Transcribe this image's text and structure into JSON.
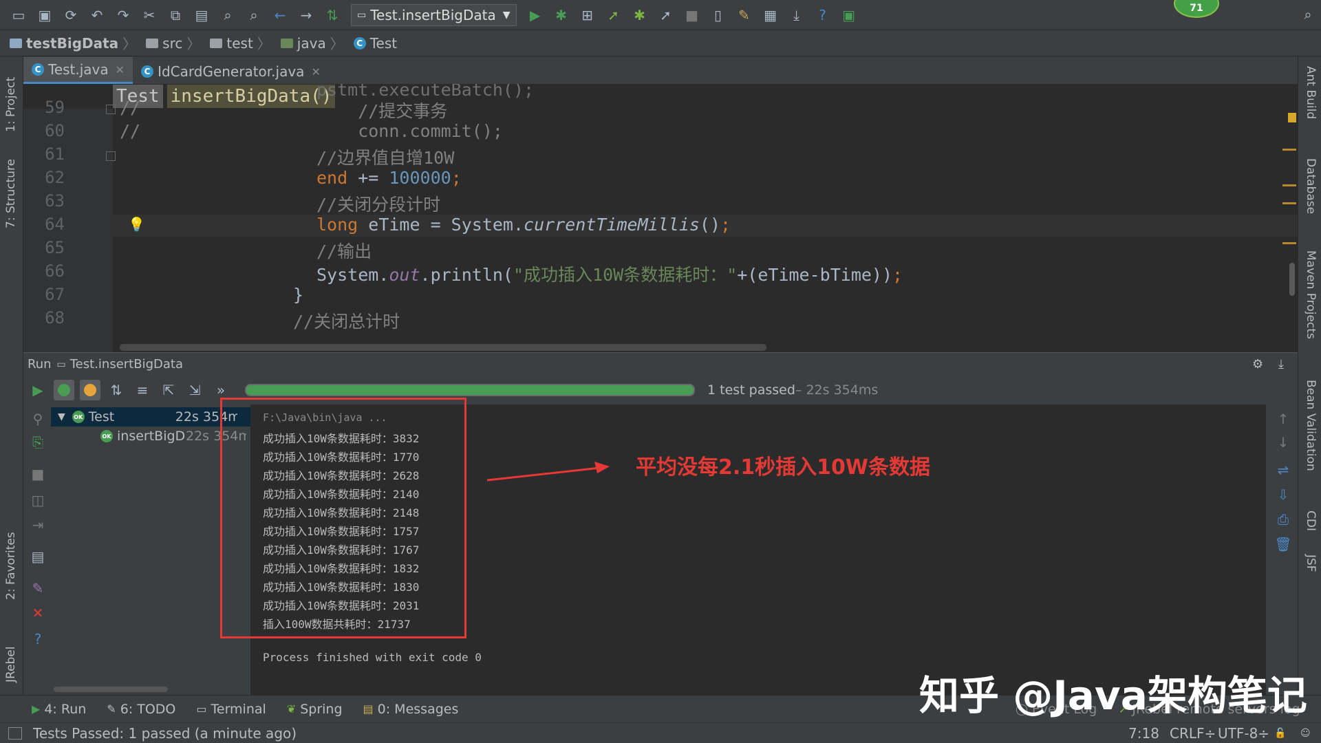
{
  "toolbar": {
    "run_config": "Test.insertBigData",
    "notification_count": "71"
  },
  "breadcrumb": [
    "testBigData",
    "src",
    "test",
    "java",
    "Test"
  ],
  "editor_tabs": [
    {
      "label": "Test.java"
    },
    {
      "label": "IdCardGenerator.java"
    }
  ],
  "editor_crumb": {
    "class": "Test",
    "method": "insertBigData()"
  },
  "editor": {
    "line_numbers": [
      "59",
      "60",
      "61",
      "62",
      "63",
      "64",
      "65",
      "66",
      "67",
      "68"
    ],
    "partial_top": "pstmt.executeBatch();",
    "l59_a": "//",
    "l59_b": "    //提交事务",
    "l60_a": "//",
    "l60_b": "    conn.commit();",
    "l61": "//边界值自增10W",
    "l62_kw": "end",
    "l62_op": " += ",
    "l62_num": "100000",
    "l62_semi": ";",
    "l63": "//关闭分段计时",
    "l64_kw": "long",
    "l64_a": " eTime = System.",
    "l64_m": "currentTimeMillis",
    "l64_b": "()",
    "l64_semi": ";",
    "l65": "//输出",
    "l66_a": "System.",
    "l66_out": "out",
    "l66_b": ".println(",
    "l66_str": "\"成功插入10W条数据耗时：\"",
    "l66_c": "+(eTime-bTime))",
    "l66_semi": ";",
    "l67": "}",
    "l68": "//关闭总计时"
  },
  "run_panel": {
    "label": "Run",
    "config": "Test.insertBigData",
    "status_main": "1 test passed",
    "status_time": " – 22s 354ms"
  },
  "tree": [
    {
      "name": "Test",
      "time": "22s 354ms"
    },
    {
      "name": "insertBigData",
      "time": "22s 354ms"
    }
  ],
  "console": {
    "cmd": "F:\\Java\\bin\\java ...",
    "lines": [
      "成功插入10W条数据耗时：3832",
      "成功插入10W条数据耗时：1770",
      "成功插入10W条数据耗时：2628",
      "成功插入10W条数据耗时：2140",
      "成功插入10W条数据耗时：2148",
      "成功插入10W条数据耗时：1757",
      "成功插入10W条数据耗时：1767",
      "成功插入10W条数据耗时：1832",
      "成功插入10W条数据耗时：1830",
      "成功插入10W条数据耗时：2031",
      "插入100W数据共耗时：21737"
    ],
    "exit": "Process finished with exit code 0"
  },
  "annotation": "平均没每2.1秒插入10W条数据",
  "left_tool_windows": [
    "1: Project",
    "7: Structure",
    "2: Favorites",
    "JRebel"
  ],
  "right_tool_windows": [
    "Ant Build",
    "Database",
    "Maven Projects",
    "Bean Validation",
    "CDI",
    "JSF"
  ],
  "bottom_tabs": [
    "4: Run",
    "6: TODO",
    "Terminal",
    "Spring",
    "0: Messages"
  ],
  "bottom_right": [
    "Event Log",
    "JRebel remote servers log"
  ],
  "status": {
    "message": "Tests Passed: 1 passed (a minute ago)",
    "position": "7:18",
    "line_sep": "CRLF÷",
    "encoding": "UTF-8÷"
  },
  "watermark": "知乎 @Java架构笔记",
  "colors": {
    "accent": "#4a88c7",
    "pass": "#499c54",
    "annotation": "#e53935"
  }
}
